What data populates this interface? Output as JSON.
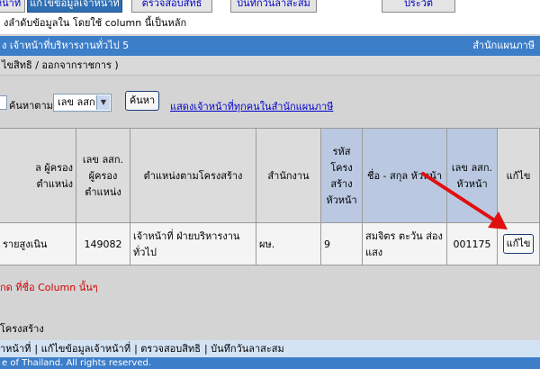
{
  "tabs": [
    {
      "label": "หน้าที่",
      "active": false
    },
    {
      "label": "แก้ไขข้อมูลเจ้าหน้าที่",
      "active": true
    },
    {
      "label": "ตรวจสอบสิทธิ",
      "active": false
    },
    {
      "label": "บันทึกวันลาสะสม",
      "active": false
    },
    {
      "label": "ประวัติ",
      "active": false
    }
  ],
  "sort_note": "งลำดับข้อมูลใน โดยใช้ column นี้เป็นหลัก",
  "title_bar": {
    "left": "ง เจ้าหน้าที่บริหารงานทั่วไป 5",
    "right": "สำนักแผนภาษี"
  },
  "sub_bar": "ไขสิทธิ / ออกจากราชการ )",
  "search": {
    "label": "ค้นหาตาม",
    "select_value": "เลข ลสก",
    "button": "ค้นหา",
    "show_all_link": "แสดงเจ้าหน้าที่ทุกคนในสำนักแผนภาษี"
  },
  "table": {
    "headers": [
      "ล ผู้ครองตำแหน่ง",
      "เลข ลสก. ผู้ครอง ตำแหน่ง",
      "ตำแหน่งตามโครงสร้าง",
      "สำนักงาน",
      "รหัส โครง สร้าง หัวหน้า",
      "ชื่อ - สกุล หัวหน้า",
      "เลข ลสก. หัวหน้า",
      "แก้ไข"
    ],
    "rows": [
      {
        "name": "รายสูงเนิน",
        "id": "149082",
        "position": "เจ้าหน้าที่ ฝ่ายบริหารงาน ทั่วไป",
        "office": "ผษ.",
        "struct_code": "9",
        "head_name": "สมจิตร ตะวัน ส่องแสง",
        "head_id": "001175",
        "edit_label": "แก้ไข"
      }
    ]
  },
  "hint": "กด ที่ชื่อ Column นั้นๆ",
  "structure_label": "โครงสร้าง",
  "footer_links": [
    "าหน้าที่",
    "แก้ไขข้อมูลเจ้าหน้าที่",
    "ตรวจสอบสิทธิ",
    "บันทึกวันลาสะสม"
  ],
  "copyright": "e of Thailand. All rights reserved.",
  "colors": {
    "header_blue": "#3d7ec9",
    "highlight_col": "#bac9e1",
    "arrow_red": "#e01010"
  }
}
